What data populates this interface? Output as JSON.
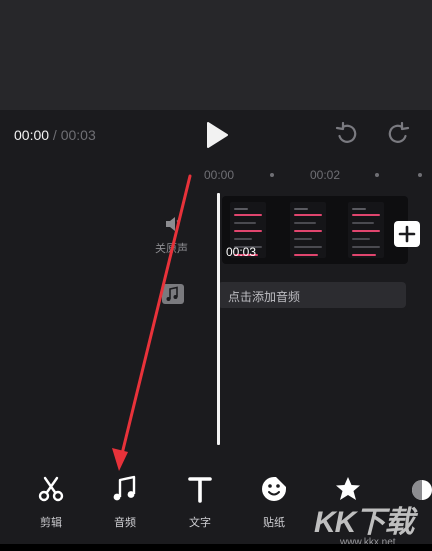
{
  "player": {
    "current_time": "00:00",
    "separator": " / ",
    "total_time": "00:03"
  },
  "ruler": {
    "marks": [
      "00:00",
      "00:02"
    ]
  },
  "tracks": {
    "mute_label": "关原声",
    "clip_duration": "00:03",
    "add_audio_label": "点击添加音频"
  },
  "toolbar": {
    "items": [
      {
        "label": "剪辑",
        "icon": "scissors-icon"
      },
      {
        "label": "音频",
        "icon": "music-note-icon"
      },
      {
        "label": "文字",
        "icon": "text-icon"
      },
      {
        "label": "贴纸",
        "icon": "sticker-icon"
      }
    ]
  },
  "watermark": {
    "brand": "KK下载",
    "url": "www.kkx.net"
  },
  "colors": {
    "background": "#1b1b1e",
    "preview": "#27272a",
    "accent_pink": "#e0456e",
    "arrow": "#e8323a"
  }
}
